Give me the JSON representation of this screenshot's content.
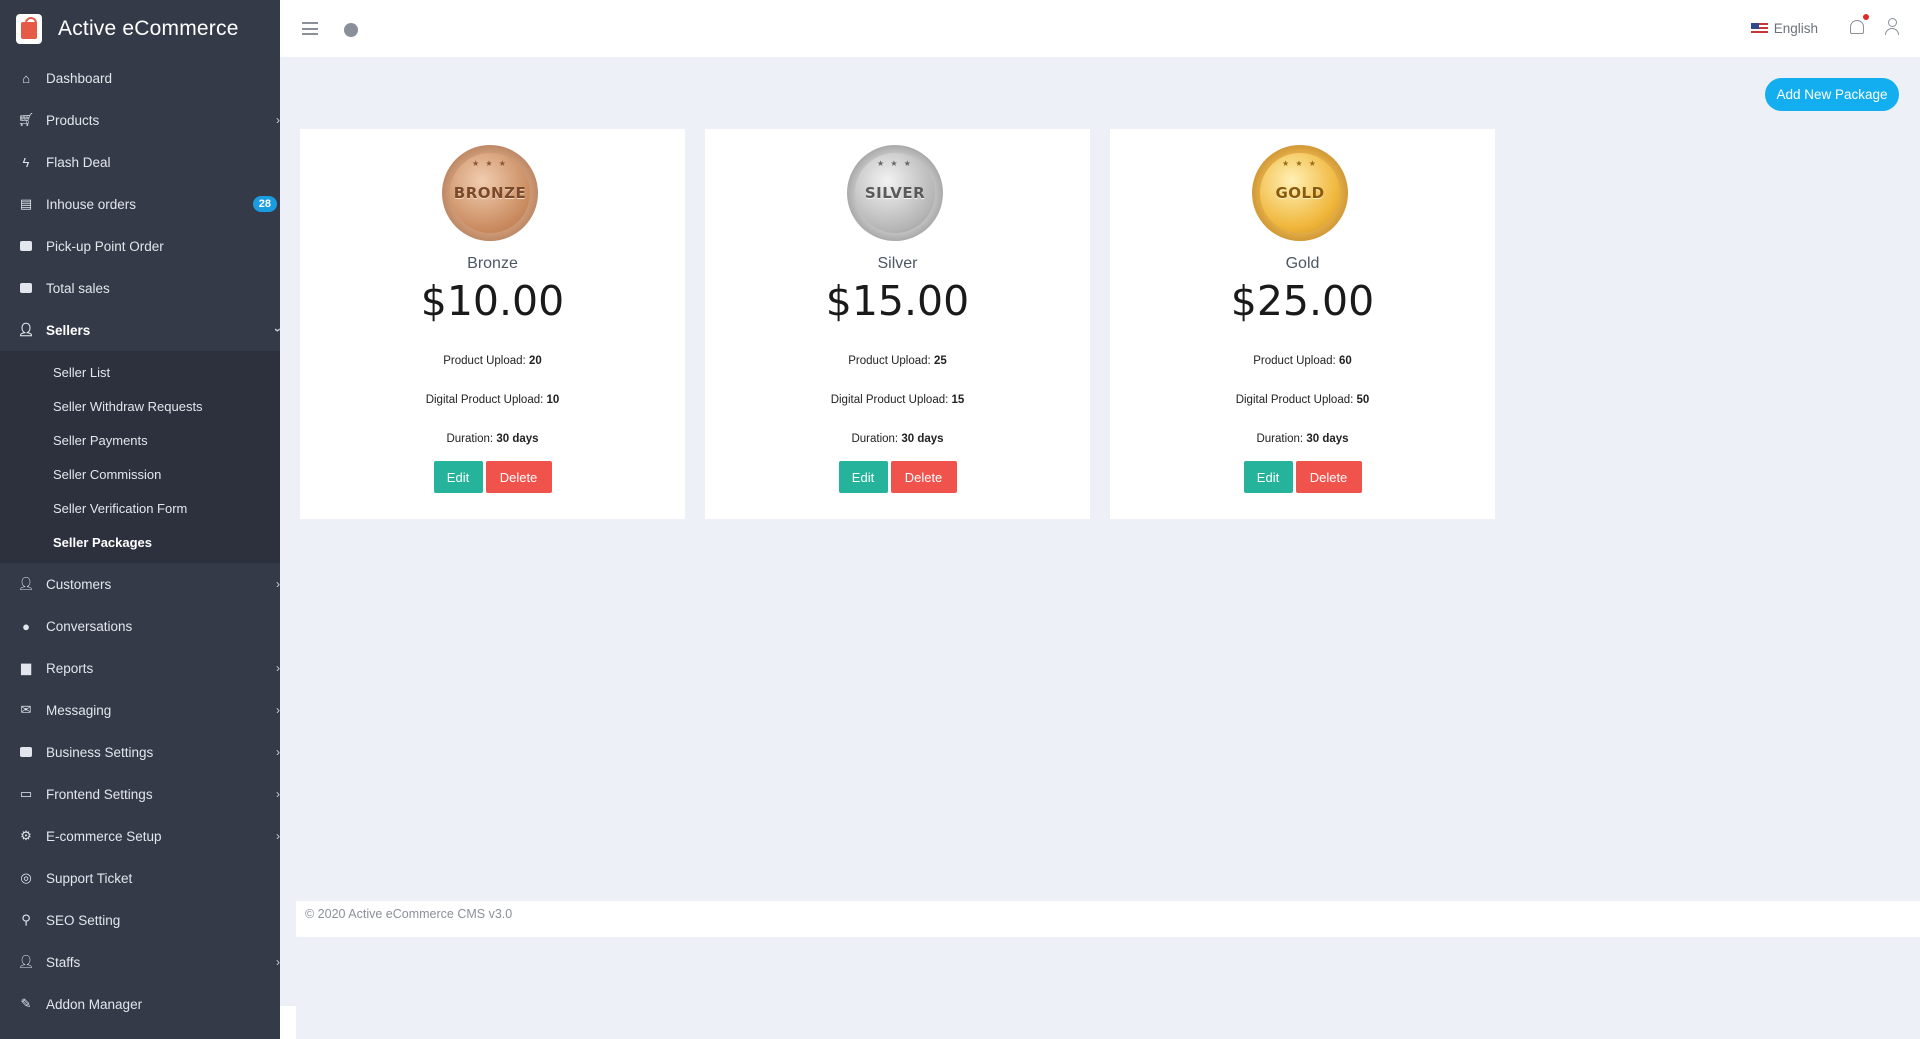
{
  "brand": {
    "name": "Active eCommerce"
  },
  "sidebar": {
    "items": [
      {
        "label": "Dashboard",
        "icon": "home-icon",
        "arrow": false
      },
      {
        "label": "Products",
        "icon": "cart-icon",
        "arrow": true
      },
      {
        "label": "Flash Deal",
        "icon": "bolt-icon",
        "arrow": false
      },
      {
        "label": "Inhouse orders",
        "icon": "basket-icon",
        "arrow": false,
        "badge": "28"
      },
      {
        "label": "Pick-up Point Order",
        "icon": "money-icon",
        "arrow": false
      },
      {
        "label": "Total sales",
        "icon": "money-icon",
        "arrow": false
      },
      {
        "label": "Sellers",
        "icon": "user-plus-icon",
        "arrow": true,
        "active": true
      }
    ],
    "sellers_submenu": [
      "Seller List",
      "Seller Withdraw Requests",
      "Seller Payments",
      "Seller Commission",
      "Seller Verification Form",
      "Seller Packages"
    ],
    "items_after": [
      {
        "label": "Customers",
        "icon": "user-plus-icon",
        "arrow": true
      },
      {
        "label": "Conversations",
        "icon": "comment-icon",
        "arrow": false
      },
      {
        "label": "Reports",
        "icon": "file-icon",
        "arrow": true
      },
      {
        "label": "Messaging",
        "icon": "envelope-icon",
        "arrow": true
      },
      {
        "label": "Business Settings",
        "icon": "briefcase-icon",
        "arrow": true
      },
      {
        "label": "Frontend Settings",
        "icon": "desktop-icon",
        "arrow": true
      },
      {
        "label": "E-commerce Setup",
        "icon": "gear-icon",
        "arrow": true
      },
      {
        "label": "Support Ticket",
        "icon": "lifebuoy-icon",
        "arrow": false
      },
      {
        "label": "SEO Setting",
        "icon": "search-icon",
        "arrow": false
      },
      {
        "label": "Staffs",
        "icon": "user-icon",
        "arrow": true
      },
      {
        "label": "Addon Manager",
        "icon": "wrench-icon",
        "arrow": false
      }
    ]
  },
  "topbar": {
    "language": "English"
  },
  "main": {
    "add_button_label": "Add New Package"
  },
  "packages": [
    {
      "name": "Bronze",
      "medal_text": "BRONZE",
      "price": "$10.00",
      "product_upload": "20",
      "digital_product_upload": "10",
      "duration": "30 days"
    },
    {
      "name": "Silver",
      "medal_text": "SILVER",
      "price": "$15.00",
      "product_upload": "25",
      "digital_product_upload": "15",
      "duration": "30 days"
    },
    {
      "name": "Gold",
      "medal_text": "GOLD",
      "price": "$25.00",
      "product_upload": "60",
      "digital_product_upload": "50",
      "duration": "30 days"
    }
  ],
  "labels": {
    "product_upload": "Product Upload:",
    "digital_product_upload": "Digital Product Upload:",
    "duration": "Duration:",
    "edit": "Edit",
    "delete": "Delete"
  },
  "footer": {
    "text": "© 2020 Active eCommerce CMS v3.0"
  },
  "colors": {
    "sidebar_bg": "#343a48",
    "accent": "#12aef0",
    "edit": "#25b39b",
    "delete": "#f0524c"
  }
}
